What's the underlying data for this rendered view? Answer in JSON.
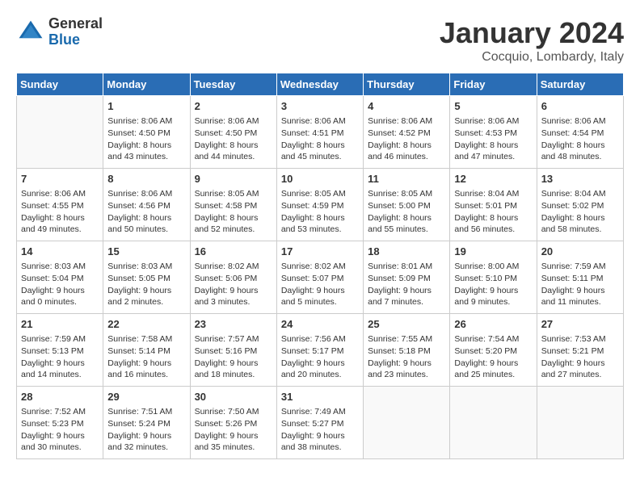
{
  "header": {
    "logo_general": "General",
    "logo_blue": "Blue",
    "month_title": "January 2024",
    "location": "Cocquio, Lombardy, Italy"
  },
  "days_of_week": [
    "Sunday",
    "Monday",
    "Tuesday",
    "Wednesday",
    "Thursday",
    "Friday",
    "Saturday"
  ],
  "weeks": [
    [
      {
        "date": "",
        "info": ""
      },
      {
        "date": "1",
        "info": "Sunrise: 8:06 AM\nSunset: 4:50 PM\nDaylight: 8 hours\nand 43 minutes."
      },
      {
        "date": "2",
        "info": "Sunrise: 8:06 AM\nSunset: 4:50 PM\nDaylight: 8 hours\nand 44 minutes."
      },
      {
        "date": "3",
        "info": "Sunrise: 8:06 AM\nSunset: 4:51 PM\nDaylight: 8 hours\nand 45 minutes."
      },
      {
        "date": "4",
        "info": "Sunrise: 8:06 AM\nSunset: 4:52 PM\nDaylight: 8 hours\nand 46 minutes."
      },
      {
        "date": "5",
        "info": "Sunrise: 8:06 AM\nSunset: 4:53 PM\nDaylight: 8 hours\nand 47 minutes."
      },
      {
        "date": "6",
        "info": "Sunrise: 8:06 AM\nSunset: 4:54 PM\nDaylight: 8 hours\nand 48 minutes."
      }
    ],
    [
      {
        "date": "7",
        "info": "Sunrise: 8:06 AM\nSunset: 4:55 PM\nDaylight: 8 hours\nand 49 minutes."
      },
      {
        "date": "8",
        "info": "Sunrise: 8:06 AM\nSunset: 4:56 PM\nDaylight: 8 hours\nand 50 minutes."
      },
      {
        "date": "9",
        "info": "Sunrise: 8:05 AM\nSunset: 4:58 PM\nDaylight: 8 hours\nand 52 minutes."
      },
      {
        "date": "10",
        "info": "Sunrise: 8:05 AM\nSunset: 4:59 PM\nDaylight: 8 hours\nand 53 minutes."
      },
      {
        "date": "11",
        "info": "Sunrise: 8:05 AM\nSunset: 5:00 PM\nDaylight: 8 hours\nand 55 minutes."
      },
      {
        "date": "12",
        "info": "Sunrise: 8:04 AM\nSunset: 5:01 PM\nDaylight: 8 hours\nand 56 minutes."
      },
      {
        "date": "13",
        "info": "Sunrise: 8:04 AM\nSunset: 5:02 PM\nDaylight: 8 hours\nand 58 minutes."
      }
    ],
    [
      {
        "date": "14",
        "info": "Sunrise: 8:03 AM\nSunset: 5:04 PM\nDaylight: 9 hours\nand 0 minutes."
      },
      {
        "date": "15",
        "info": "Sunrise: 8:03 AM\nSunset: 5:05 PM\nDaylight: 9 hours\nand 2 minutes."
      },
      {
        "date": "16",
        "info": "Sunrise: 8:02 AM\nSunset: 5:06 PM\nDaylight: 9 hours\nand 3 minutes."
      },
      {
        "date": "17",
        "info": "Sunrise: 8:02 AM\nSunset: 5:07 PM\nDaylight: 9 hours\nand 5 minutes."
      },
      {
        "date": "18",
        "info": "Sunrise: 8:01 AM\nSunset: 5:09 PM\nDaylight: 9 hours\nand 7 minutes."
      },
      {
        "date": "19",
        "info": "Sunrise: 8:00 AM\nSunset: 5:10 PM\nDaylight: 9 hours\nand 9 minutes."
      },
      {
        "date": "20",
        "info": "Sunrise: 7:59 AM\nSunset: 5:11 PM\nDaylight: 9 hours\nand 11 minutes."
      }
    ],
    [
      {
        "date": "21",
        "info": "Sunrise: 7:59 AM\nSunset: 5:13 PM\nDaylight: 9 hours\nand 14 minutes."
      },
      {
        "date": "22",
        "info": "Sunrise: 7:58 AM\nSunset: 5:14 PM\nDaylight: 9 hours\nand 16 minutes."
      },
      {
        "date": "23",
        "info": "Sunrise: 7:57 AM\nSunset: 5:16 PM\nDaylight: 9 hours\nand 18 minutes."
      },
      {
        "date": "24",
        "info": "Sunrise: 7:56 AM\nSunset: 5:17 PM\nDaylight: 9 hours\nand 20 minutes."
      },
      {
        "date": "25",
        "info": "Sunrise: 7:55 AM\nSunset: 5:18 PM\nDaylight: 9 hours\nand 23 minutes."
      },
      {
        "date": "26",
        "info": "Sunrise: 7:54 AM\nSunset: 5:20 PM\nDaylight: 9 hours\nand 25 minutes."
      },
      {
        "date": "27",
        "info": "Sunrise: 7:53 AM\nSunset: 5:21 PM\nDaylight: 9 hours\nand 27 minutes."
      }
    ],
    [
      {
        "date": "28",
        "info": "Sunrise: 7:52 AM\nSunset: 5:23 PM\nDaylight: 9 hours\nand 30 minutes."
      },
      {
        "date": "29",
        "info": "Sunrise: 7:51 AM\nSunset: 5:24 PM\nDaylight: 9 hours\nand 32 minutes."
      },
      {
        "date": "30",
        "info": "Sunrise: 7:50 AM\nSunset: 5:26 PM\nDaylight: 9 hours\nand 35 minutes."
      },
      {
        "date": "31",
        "info": "Sunrise: 7:49 AM\nSunset: 5:27 PM\nDaylight: 9 hours\nand 38 minutes."
      },
      {
        "date": "",
        "info": ""
      },
      {
        "date": "",
        "info": ""
      },
      {
        "date": "",
        "info": ""
      }
    ]
  ]
}
